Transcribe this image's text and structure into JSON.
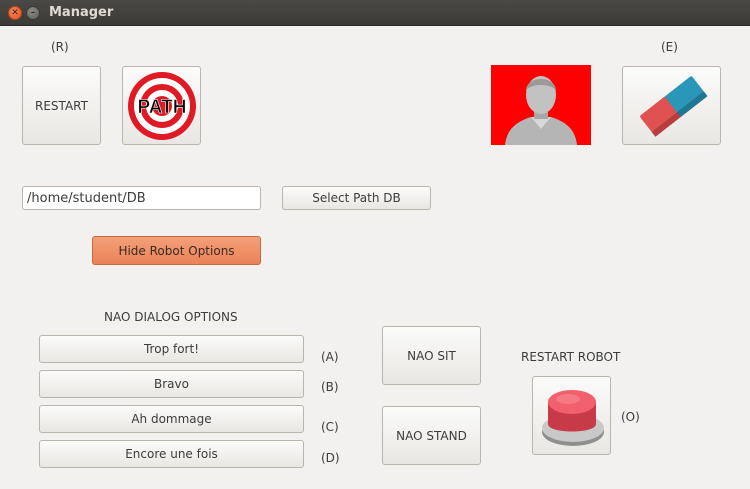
{
  "window": {
    "title": "Manager"
  },
  "shortcuts": {
    "r": "(R)",
    "e": "(E)",
    "a": "(A)",
    "b": "(B)",
    "c": "(C)",
    "d": "(D)",
    "o": "(O)"
  },
  "buttons": {
    "restart": "RESTART",
    "path_icon_text": "PATH",
    "select_path": "Select Path DB",
    "hide_robot": "Hide Robot Options",
    "nao_sit": "NAO SIT",
    "nao_stand": "NAO STAND"
  },
  "path_input": {
    "value": "/home/student/DB"
  },
  "dialog": {
    "heading": "NAO DIALOG OPTIONS",
    "options": [
      "Trop fort!",
      "Bravo",
      "Ah dommage",
      "Encore une fois"
    ]
  },
  "restart_robot": {
    "label": "RESTART ROBOT"
  },
  "colors": {
    "accent": "#eb8257",
    "avatar_bg": "#ff0000",
    "target_red": "#e01a24"
  },
  "icons": {
    "path": "target-icon",
    "user": "user-avatar-icon",
    "eraser": "eraser-icon",
    "restart_robot": "red-push-button-icon"
  }
}
